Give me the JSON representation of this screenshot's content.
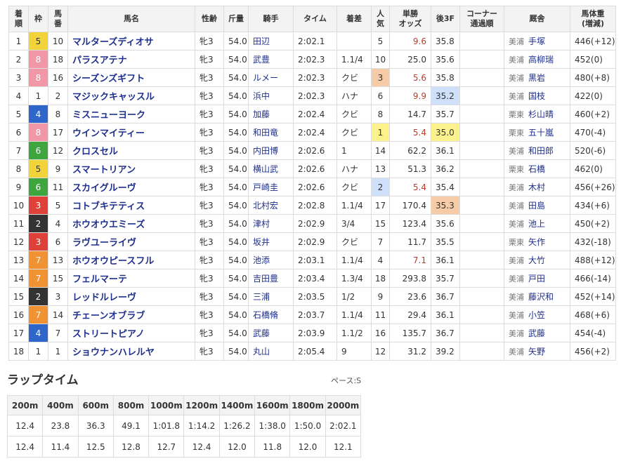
{
  "headers": {
    "finish": "着\n順",
    "waku": "枠",
    "num": "馬\n番",
    "horse": "馬名",
    "sexage": "性齢",
    "weight": "斤量",
    "jockey": "騎手",
    "time": "タイム",
    "margin": "着差",
    "pop": "人\n気",
    "odds": "単勝\nオッズ",
    "last3f": "後3F",
    "corner": "コーナー\n通過順",
    "trainer": "厩舎",
    "bw": "馬体重\n(増減)"
  },
  "colors": {
    "waku": {
      "1": {
        "bg": "#ffffff",
        "fg": "#333333"
      },
      "2": {
        "bg": "#333333",
        "fg": "#ffffff"
      },
      "3": {
        "bg": "#e0403a",
        "fg": "#ffffff"
      },
      "4": {
        "bg": "#2f66c9",
        "fg": "#ffffff"
      },
      "5": {
        "bg": "#f0d43a",
        "fg": "#333333"
      },
      "6": {
        "bg": "#3fa53f",
        "fg": "#ffffff"
      },
      "7": {
        "bg": "#f19333",
        "fg": "#ffffff"
      },
      "8": {
        "bg": "#f197a8",
        "fg": "#ffffff"
      }
    },
    "pop_rank": {
      "1": "#fbf28e",
      "2": "#cfe0fb",
      "3": "#f5cba8"
    },
    "last3f_rank": {
      "1": "#fbf28e",
      "2": "#cfe0fb",
      "3": "#f5cba8"
    },
    "odds_highlight": "#c0392b"
  },
  "rows": [
    {
      "finish": "1",
      "waku": "5",
      "num": "10",
      "horse": "マルターズディオサ",
      "sexage": "牝3",
      "weight": "54.0",
      "jockey": "田辺",
      "time": "2:02.1",
      "margin": "",
      "pop": "5",
      "odds": "9.6",
      "odds_hl": true,
      "last3f": "35.8",
      "last3f_rank": "",
      "pop_rank": "",
      "corner": "",
      "trainer_loc": "美浦",
      "trainer": "手塚",
      "bw": "446(+12)"
    },
    {
      "finish": "2",
      "waku": "8",
      "num": "18",
      "horse": "パラスアテナ",
      "sexage": "牝3",
      "weight": "54.0",
      "jockey": "武豊",
      "time": "2:02.3",
      "margin": "1.1/4",
      "pop": "10",
      "odds": "25.0",
      "odds_hl": false,
      "last3f": "35.6",
      "last3f_rank": "",
      "pop_rank": "",
      "corner": "",
      "trainer_loc": "美浦",
      "trainer": "高柳瑞",
      "bw": "452(0)"
    },
    {
      "finish": "3",
      "waku": "8",
      "num": "16",
      "horse": "シーズンズギフト",
      "sexage": "牝3",
      "weight": "54.0",
      "jockey": "ルメー",
      "time": "2:02.3",
      "margin": "クビ",
      "pop": "3",
      "odds": "5.6",
      "odds_hl": true,
      "last3f": "35.8",
      "last3f_rank": "",
      "pop_rank": "3",
      "corner": "",
      "trainer_loc": "美浦",
      "trainer": "黒岩",
      "bw": "480(+8)"
    },
    {
      "finish": "4",
      "waku": "1",
      "num": "2",
      "horse": "マジックキャッスル",
      "sexage": "牝3",
      "weight": "54.0",
      "jockey": "浜中",
      "time": "2:02.3",
      "margin": "ハナ",
      "pop": "6",
      "odds": "9.9",
      "odds_hl": true,
      "last3f": "35.2",
      "last3f_rank": "2",
      "pop_rank": "",
      "corner": "",
      "trainer_loc": "美浦",
      "trainer": "国枝",
      "bw": "422(0)"
    },
    {
      "finish": "5",
      "waku": "4",
      "num": "8",
      "horse": "ミスニューヨーク",
      "sexage": "牝3",
      "weight": "54.0",
      "jockey": "加藤",
      "time": "2:02.4",
      "margin": "クビ",
      "pop": "8",
      "odds": "14.7",
      "odds_hl": false,
      "last3f": "35.7",
      "last3f_rank": "",
      "pop_rank": "",
      "corner": "",
      "trainer_loc": "栗東",
      "trainer": "杉山晴",
      "bw": "460(+2)"
    },
    {
      "finish": "6",
      "waku": "8",
      "num": "17",
      "horse": "ウインマイティー",
      "sexage": "牝3",
      "weight": "54.0",
      "jockey": "和田竜",
      "time": "2:02.4",
      "margin": "クビ",
      "pop": "1",
      "odds": "5.4",
      "odds_hl": true,
      "last3f": "35.0",
      "last3f_rank": "1",
      "pop_rank": "1",
      "corner": "",
      "trainer_loc": "栗東",
      "trainer": "五十嵐",
      "bw": "470(-4)"
    },
    {
      "finish": "7",
      "waku": "6",
      "num": "12",
      "horse": "クロスセル",
      "sexage": "牝3",
      "weight": "54.0",
      "jockey": "内田博",
      "time": "2:02.6",
      "margin": "1",
      "pop": "14",
      "odds": "62.2",
      "odds_hl": false,
      "last3f": "36.1",
      "last3f_rank": "",
      "pop_rank": "",
      "corner": "",
      "trainer_loc": "美浦",
      "trainer": "和田郎",
      "bw": "520(-6)"
    },
    {
      "finish": "8",
      "waku": "5",
      "num": "9",
      "horse": "スマートリアン",
      "sexage": "牝3",
      "weight": "54.0",
      "jockey": "横山武",
      "time": "2:02.6",
      "margin": "ハナ",
      "pop": "13",
      "odds": "51.3",
      "odds_hl": false,
      "last3f": "36.2",
      "last3f_rank": "",
      "pop_rank": "",
      "corner": "",
      "trainer_loc": "栗東",
      "trainer": "石橋",
      "bw": "462(0)"
    },
    {
      "finish": "9",
      "waku": "6",
      "num": "11",
      "horse": "スカイグルーヴ",
      "sexage": "牝3",
      "weight": "54.0",
      "jockey": "戸崎圭",
      "time": "2:02.6",
      "margin": "クビ",
      "pop": "2",
      "odds": "5.4",
      "odds_hl": true,
      "last3f": "35.4",
      "last3f_rank": "",
      "pop_rank": "2",
      "corner": "",
      "trainer_loc": "美浦",
      "trainer": "木村",
      "bw": "456(+26)"
    },
    {
      "finish": "10",
      "waku": "3",
      "num": "5",
      "horse": "コトブキテティス",
      "sexage": "牝3",
      "weight": "54.0",
      "jockey": "北村宏",
      "time": "2:02.8",
      "margin": "1.1/4",
      "pop": "17",
      "odds": "170.4",
      "odds_hl": false,
      "last3f": "35.3",
      "last3f_rank": "3",
      "pop_rank": "",
      "corner": "",
      "trainer_loc": "美浦",
      "trainer": "田島",
      "bw": "434(+6)"
    },
    {
      "finish": "11",
      "waku": "2",
      "num": "4",
      "horse": "ホウオウエミーズ",
      "sexage": "牝3",
      "weight": "54.0",
      "jockey": "津村",
      "time": "2:02.9",
      "margin": "3/4",
      "pop": "15",
      "odds": "123.4",
      "odds_hl": false,
      "last3f": "35.6",
      "last3f_rank": "",
      "pop_rank": "",
      "corner": "",
      "trainer_loc": "美浦",
      "trainer": "池上",
      "bw": "450(+2)"
    },
    {
      "finish": "12",
      "waku": "3",
      "num": "6",
      "horse": "ラヴユーライヴ",
      "sexage": "牝3",
      "weight": "54.0",
      "jockey": "坂井",
      "time": "2:02.9",
      "margin": "クビ",
      "pop": "7",
      "odds": "11.7",
      "odds_hl": false,
      "last3f": "35.5",
      "last3f_rank": "",
      "pop_rank": "",
      "corner": "",
      "trainer_loc": "栗東",
      "trainer": "矢作",
      "bw": "432(-18)"
    },
    {
      "finish": "13",
      "waku": "7",
      "num": "13",
      "horse": "ホウオウピースフル",
      "sexage": "牝3",
      "weight": "54.0",
      "jockey": "池添",
      "time": "2:03.1",
      "margin": "1.1/4",
      "pop": "4",
      "odds": "7.1",
      "odds_hl": true,
      "last3f": "36.1",
      "last3f_rank": "",
      "pop_rank": "",
      "corner": "",
      "trainer_loc": "美浦",
      "trainer": "大竹",
      "bw": "488(+12)"
    },
    {
      "finish": "14",
      "waku": "7",
      "num": "15",
      "horse": "フェルマーテ",
      "sexage": "牝3",
      "weight": "54.0",
      "jockey": "吉田豊",
      "time": "2:03.4",
      "margin": "1.3/4",
      "pop": "18",
      "odds": "293.8",
      "odds_hl": false,
      "last3f": "35.7",
      "last3f_rank": "",
      "pop_rank": "",
      "corner": "",
      "trainer_loc": "美浦",
      "trainer": "戸田",
      "bw": "466(-14)"
    },
    {
      "finish": "15",
      "waku": "2",
      "num": "3",
      "horse": "レッドルレーヴ",
      "sexage": "牝3",
      "weight": "54.0",
      "jockey": "三浦",
      "time": "2:03.5",
      "margin": "1/2",
      "pop": "9",
      "odds": "23.6",
      "odds_hl": false,
      "last3f": "36.7",
      "last3f_rank": "",
      "pop_rank": "",
      "corner": "",
      "trainer_loc": "美浦",
      "trainer": "藤沢和",
      "bw": "452(+14)"
    },
    {
      "finish": "16",
      "waku": "7",
      "num": "14",
      "horse": "チェーンオブラブ",
      "sexage": "牝3",
      "weight": "54.0",
      "jockey": "石橋脩",
      "time": "2:03.7",
      "margin": "1.1/4",
      "pop": "11",
      "odds": "29.4",
      "odds_hl": false,
      "last3f": "36.1",
      "last3f_rank": "",
      "pop_rank": "",
      "corner": "",
      "trainer_loc": "美浦",
      "trainer": "小笠",
      "bw": "468(+6)"
    },
    {
      "finish": "17",
      "waku": "4",
      "num": "7",
      "horse": "ストリートピアノ",
      "sexage": "牝3",
      "weight": "54.0",
      "jockey": "武藤",
      "time": "2:03.9",
      "margin": "1.1/2",
      "pop": "16",
      "odds": "135.7",
      "odds_hl": false,
      "last3f": "36.7",
      "last3f_rank": "",
      "pop_rank": "",
      "corner": "",
      "trainer_loc": "美浦",
      "trainer": "武藤",
      "bw": "454(-4)"
    },
    {
      "finish": "18",
      "waku": "1",
      "num": "1",
      "horse": "ショウナンハレルヤ",
      "sexage": "牝3",
      "weight": "54.0",
      "jockey": "丸山",
      "time": "2:05.4",
      "margin": "9",
      "pop": "12",
      "odds": "31.2",
      "odds_hl": false,
      "last3f": "39.2",
      "last3f_rank": "",
      "pop_rank": "",
      "corner": "",
      "trainer_loc": "美浦",
      "trainer": "矢野",
      "bw": "456(+2)"
    }
  ],
  "lap": {
    "heading": "ラップタイム",
    "pace": "ペース:S",
    "distances": [
      "200m",
      "400m",
      "600m",
      "800m",
      "1000m",
      "1200m",
      "1400m",
      "1600m",
      "1800m",
      "2000m"
    ],
    "cumulative": [
      "12.4",
      "23.8",
      "36.3",
      "49.1",
      "1:01.8",
      "1:14.2",
      "1:26.2",
      "1:38.0",
      "1:50.0",
      "2:02.1"
    ],
    "splits": [
      "12.4",
      "11.4",
      "12.5",
      "12.8",
      "12.7",
      "12.4",
      "12.0",
      "11.8",
      "12.0",
      "12.1"
    ]
  }
}
